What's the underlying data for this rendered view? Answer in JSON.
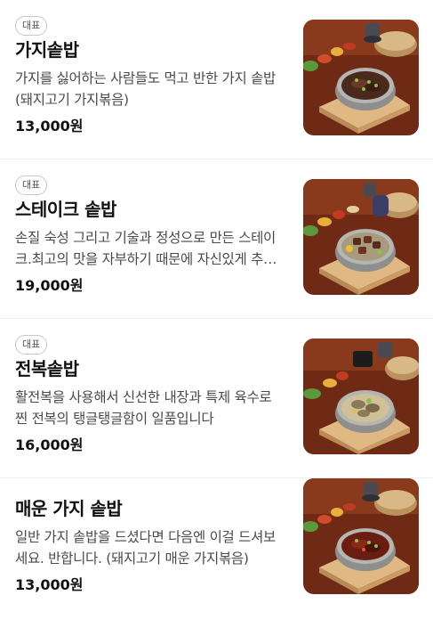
{
  "menu": {
    "items": [
      {
        "badge": "대표",
        "name": "가지솥밥",
        "description": "가지를 싫어하는 사람들도 먹고 반한 가지 솥밥 (돼지고기 가지볶음)",
        "price": "13,000원",
        "image_icon": "eggplant-pot-rice-photo"
      },
      {
        "badge": "대표",
        "name": "스테이크 솥밥",
        "description": "손질 숙성 그리고 기술과 정성으로 만든 스테이크.최고의 맛을 자부하기 때문에 자신있게 추천드립니다",
        "price": "19,000원",
        "image_icon": "steak-pot-rice-photo"
      },
      {
        "badge": "대표",
        "name": "전복솥밥",
        "description": "활전복을 사용해서 신선한 내장과 특제 육수로 찐 전복의 탱글탱글함이 일품입니다",
        "price": "16,000원",
        "image_icon": "abalone-pot-rice-photo"
      },
      {
        "badge": "",
        "name": "매운 가지 솥밥",
        "description": "일반 가지 솥밥을 드셨다면 다음엔 이걸 드셔보세요. 반합니다. (돼지고기 매운 가지볶음)",
        "price": "13,000원",
        "image_icon": "spicy-eggplant-pot-rice-photo"
      }
    ]
  },
  "colors": {
    "table_wood": "#7a2e16",
    "tray_wood": "#dcae78",
    "pot_metal": "#9a9a98",
    "badge_border": "#c8c8c8"
  }
}
